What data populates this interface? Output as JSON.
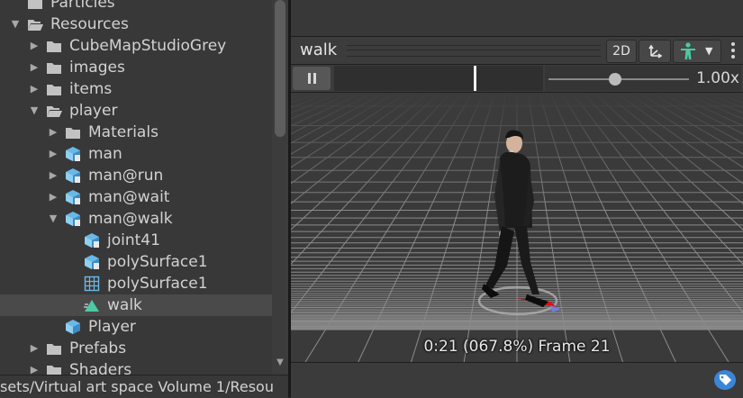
{
  "tree": {
    "items": [
      {
        "label": "Particles",
        "icon": "folder-icon",
        "arrow": "",
        "selected": false
      },
      {
        "label": "Resources",
        "icon": "folder-open-icon",
        "arrow": "expanded",
        "selected": false
      },
      {
        "label": "CubeMapStudioGrey",
        "icon": "folder-icon",
        "arrow": "collapsed",
        "selected": false
      },
      {
        "label": "images",
        "icon": "folder-icon",
        "arrow": "collapsed",
        "selected": false
      },
      {
        "label": "items",
        "icon": "folder-icon",
        "arrow": "collapsed",
        "selected": false
      },
      {
        "label": "player",
        "icon": "folder-open-icon",
        "arrow": "expanded",
        "selected": false
      },
      {
        "label": "Materials",
        "icon": "folder-icon",
        "arrow": "collapsed",
        "selected": false
      },
      {
        "label": "man",
        "icon": "prefab-model-icon",
        "arrow": "collapsed",
        "selected": false
      },
      {
        "label": "man@run",
        "icon": "prefab-model-icon",
        "arrow": "collapsed",
        "selected": false
      },
      {
        "label": "man@wait",
        "icon": "prefab-model-icon",
        "arrow": "collapsed",
        "selected": false
      },
      {
        "label": "man@walk",
        "icon": "prefab-model-icon",
        "arrow": "expanded",
        "selected": false
      },
      {
        "label": "joint41",
        "icon": "prefab-model-icon",
        "arrow": "",
        "selected": false
      },
      {
        "label": "polySurface1",
        "icon": "prefab-model-icon",
        "arrow": "",
        "selected": false
      },
      {
        "label": "polySurface1",
        "icon": "mesh-grid-icon",
        "arrow": "",
        "selected": false
      },
      {
        "label": "walk",
        "icon": "animation-clip-icon",
        "arrow": "",
        "selected": true
      },
      {
        "label": "Player",
        "icon": "prefab-icon",
        "arrow": "",
        "selected": false
      },
      {
        "label": "Prefabs",
        "icon": "folder-icon",
        "arrow": "collapsed",
        "selected": false
      },
      {
        "label": "Shaders",
        "icon": "folder-icon",
        "arrow": "collapsed",
        "selected": false
      }
    ]
  },
  "path_bar": {
    "text": "sets/Virtual art space Volume 1/Resou"
  },
  "preview": {
    "title": "walk",
    "mode_2d_label": "2D",
    "pivot_icon": "pivot-axes-icon",
    "avatar_icon": "avatar-figure-icon",
    "menu_icon": "more-vertical-icon",
    "speed_label": "1.00x",
    "speed_value": 1.0,
    "playhead_fraction": 0.678,
    "frame_info": "0:21 (067.8%) Frame 21"
  },
  "colors": {
    "accent_green": "#4dc9a4",
    "tag_blue": "#3b86d6",
    "selection": "#4a4a4a"
  }
}
